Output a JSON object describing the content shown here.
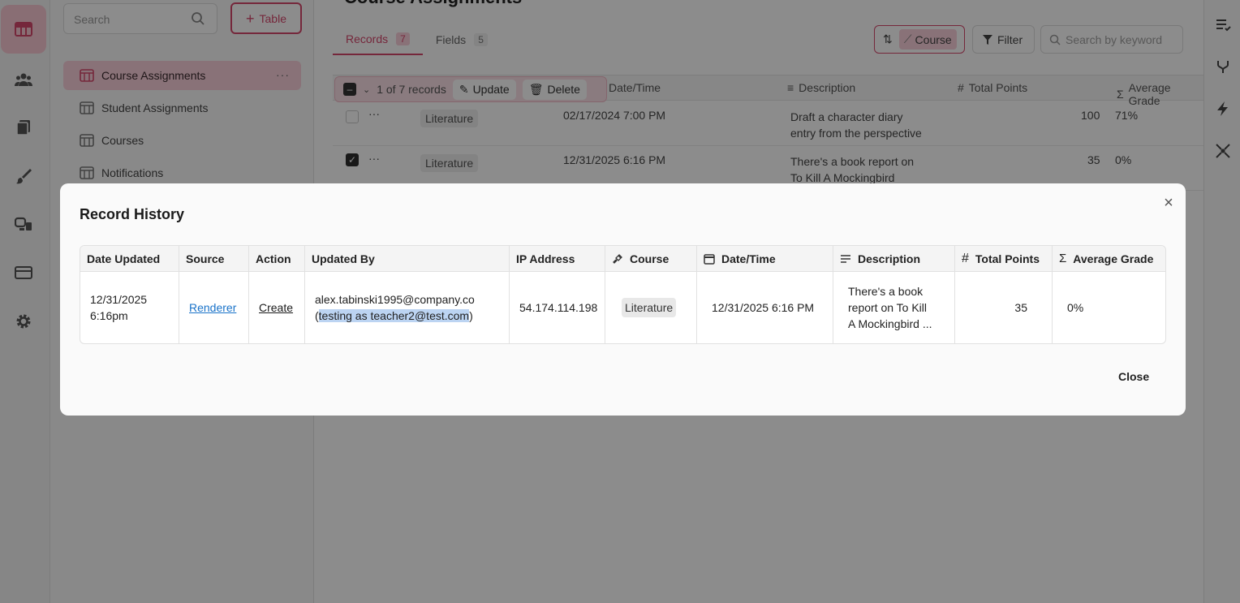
{
  "sidebar": {
    "search_placeholder": "Search",
    "new_table_label": "Table",
    "tables": [
      {
        "label": "Course Assignments",
        "active": true
      },
      {
        "label": "Student Assignments",
        "active": false
      },
      {
        "label": "Courses",
        "active": false
      },
      {
        "label": "Notifications",
        "active": false
      }
    ]
  },
  "rail_icons": [
    "tables-icon",
    "users-icon",
    "documents-icon",
    "brush-icon",
    "interfaces-icon",
    "forms-icon",
    "settings-icon"
  ],
  "main": {
    "title": "Course Assignments",
    "tabs": [
      {
        "label": "Records",
        "count": "7",
        "active": true
      },
      {
        "label": "Fields",
        "count": "5",
        "active": false
      }
    ],
    "toolbar": {
      "group_label": "Course",
      "filter_label": "Filter",
      "keyword_placeholder": "Search by keyword"
    },
    "selection": {
      "summary": "1 of 7 records",
      "update_label": "Update",
      "delete_label": "Delete"
    },
    "grid_headers": [
      "Date/Time",
      "Description",
      "Total Points",
      "Average Grade"
    ],
    "grid_rows": [
      {
        "course": "Literature",
        "datetime": "02/17/2024 7:00 PM",
        "description_l1": "Draft a character diary",
        "description_l2": "entry from the perspective",
        "points": "100",
        "avg": "71%",
        "checked": false
      },
      {
        "course": "Literature",
        "datetime": "12/31/2025 6:16 PM",
        "description_l1": "There's a book report on",
        "description_l2": "To Kill A Mockingbird",
        "points": "35",
        "avg": "0%",
        "checked": true
      }
    ]
  },
  "modal": {
    "title": "Record History",
    "close_label": "Close",
    "columns": {
      "date_updated": "Date Updated",
      "source": "Source",
      "action": "Action",
      "updated_by": "Updated By",
      "ip": "IP Address",
      "course": "Course",
      "datetime": "Date/Time",
      "description": "Description",
      "total_points": "Total Points",
      "average_grade": "Average Grade"
    },
    "row": {
      "date_l1": "12/31/2025",
      "date_l2": "6:16pm",
      "source": "Renderer",
      "action": "Create",
      "updated_by_email": "alex.tabinski1995@company.co",
      "updated_by_open": "(",
      "updated_by_testing": "testing as teacher2@test.com",
      "updated_by_close": ")",
      "ip": "54.174.114.198",
      "course": "Literature",
      "datetime": "12/31/2025 6:16 PM",
      "description_l1": "There's a book",
      "description_l2": "report on To Kill",
      "description_l3": "A Mockingbird ...",
      "total_points": "35",
      "average_grade": "0%"
    }
  },
  "colors": {
    "accent": "#d6476c",
    "accent_light": "#fad0da",
    "link": "#1a73c9",
    "highlight": "#bcd4f2"
  }
}
